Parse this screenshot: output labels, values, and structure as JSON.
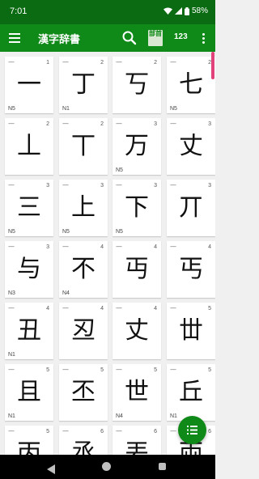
{
  "status": {
    "time": "7:01",
    "battery": "58%"
  },
  "appbar": {
    "title": "漢字辞書",
    "radical_icon_text": "部首",
    "stroke_icon_text": "123"
  },
  "colors": {
    "statusbar": "#0a6b12",
    "appbar": "#0f8a18",
    "scroll_indicator": "#e2427a",
    "fab": "#0f8a18"
  },
  "kanji_list": [
    {
      "char": "一",
      "strokes": "1",
      "jlpt": "N5"
    },
    {
      "char": "丁",
      "strokes": "2",
      "jlpt": "N1"
    },
    {
      "char": "丂",
      "strokes": "2",
      "jlpt": ""
    },
    {
      "char": "七",
      "strokes": "2",
      "jlpt": "N5"
    },
    {
      "char": "丄",
      "strokes": "2",
      "jlpt": ""
    },
    {
      "char": "丅",
      "strokes": "2",
      "jlpt": ""
    },
    {
      "char": "万",
      "strokes": "3",
      "jlpt": "N5"
    },
    {
      "char": "丈",
      "strokes": "3",
      "jlpt": ""
    },
    {
      "char": "三",
      "strokes": "3",
      "jlpt": "N5"
    },
    {
      "char": "上",
      "strokes": "3",
      "jlpt": "N5"
    },
    {
      "char": "下",
      "strokes": "3",
      "jlpt": "N5"
    },
    {
      "char": "丌",
      "strokes": "3",
      "jlpt": ""
    },
    {
      "char": "与",
      "strokes": "3",
      "jlpt": "N3"
    },
    {
      "char": "不",
      "strokes": "4",
      "jlpt": "N4"
    },
    {
      "char": "丏",
      "strokes": "4",
      "jlpt": ""
    },
    {
      "char": "丐",
      "strokes": "4",
      "jlpt": ""
    },
    {
      "char": "丑",
      "strokes": "4",
      "jlpt": "N1"
    },
    {
      "char": "丒",
      "strokes": "4",
      "jlpt": ""
    },
    {
      "char": "丈",
      "strokes": "4",
      "jlpt": ""
    },
    {
      "char": "丗",
      "strokes": "5",
      "jlpt": ""
    },
    {
      "char": "且",
      "strokes": "5",
      "jlpt": "N1"
    },
    {
      "char": "丕",
      "strokes": "5",
      "jlpt": ""
    },
    {
      "char": "世",
      "strokes": "5",
      "jlpt": "N4"
    },
    {
      "char": "丘",
      "strokes": "5",
      "jlpt": "N1"
    },
    {
      "char": "丙",
      "strokes": "5",
      "jlpt": ""
    },
    {
      "char": "丞",
      "strokes": "6",
      "jlpt": ""
    },
    {
      "char": "丟",
      "strokes": "6",
      "jlpt": ""
    },
    {
      "char": "両",
      "strokes": "6",
      "jlpt": ""
    }
  ],
  "icons": [
    "menu-icon",
    "search-icon",
    "radical-icon",
    "stroke-count-icon",
    "more-vert-icon",
    "list-icon",
    "nav-back-icon",
    "nav-home-icon",
    "nav-recent-icon"
  ]
}
